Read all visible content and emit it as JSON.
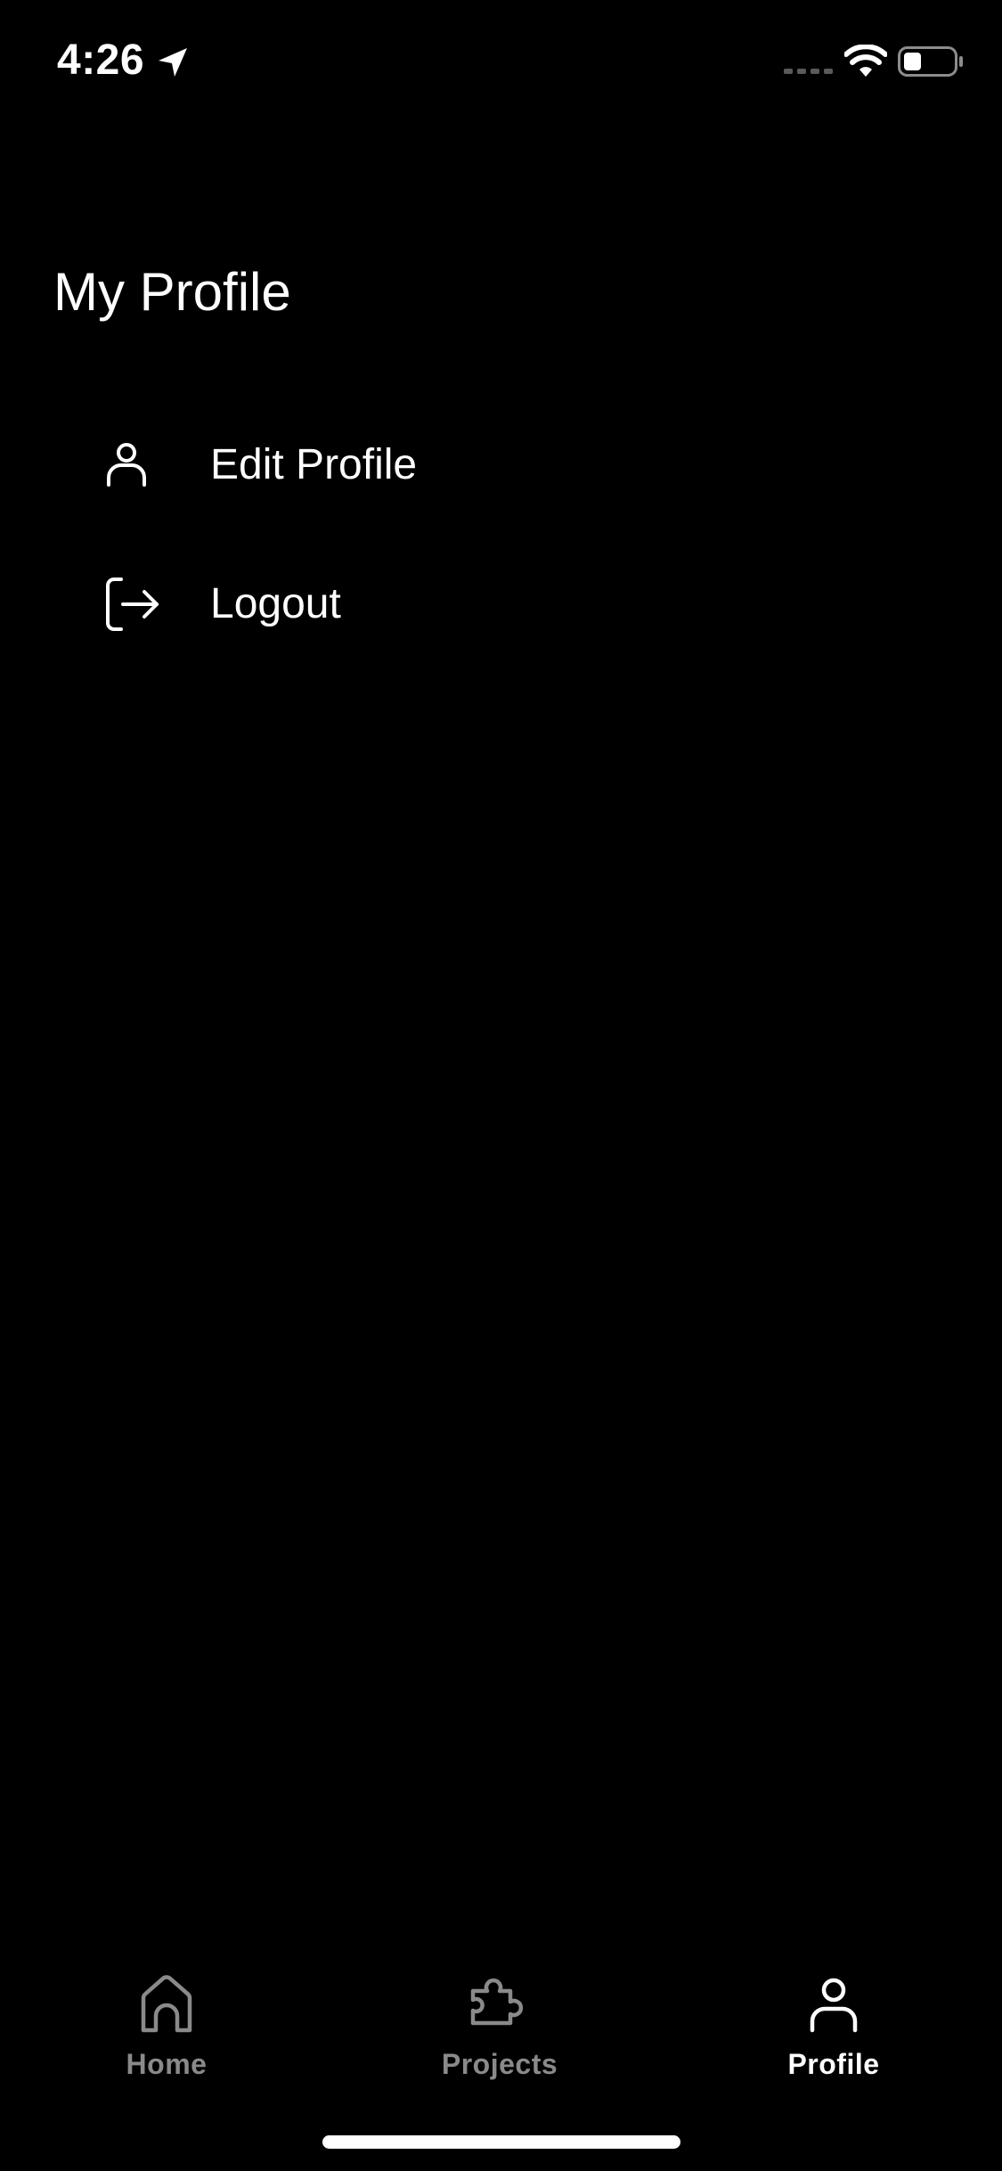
{
  "status_bar": {
    "time": "4:26",
    "battery_level": 0.35
  },
  "page": {
    "title": "My Profile"
  },
  "menu": {
    "items": [
      {
        "label": "Edit Profile",
        "icon": "person-icon"
      },
      {
        "label": "Logout",
        "icon": "logout-icon"
      }
    ]
  },
  "tab_bar": {
    "tabs": [
      {
        "label": "Home",
        "icon": "home-icon",
        "active": false
      },
      {
        "label": "Projects",
        "icon": "puzzle-icon",
        "active": false
      },
      {
        "label": "Profile",
        "icon": "person-icon",
        "active": true
      }
    ]
  },
  "colors": {
    "background": "#000000",
    "text": "#ffffff",
    "inactive_tab": "#8a8a8a"
  }
}
